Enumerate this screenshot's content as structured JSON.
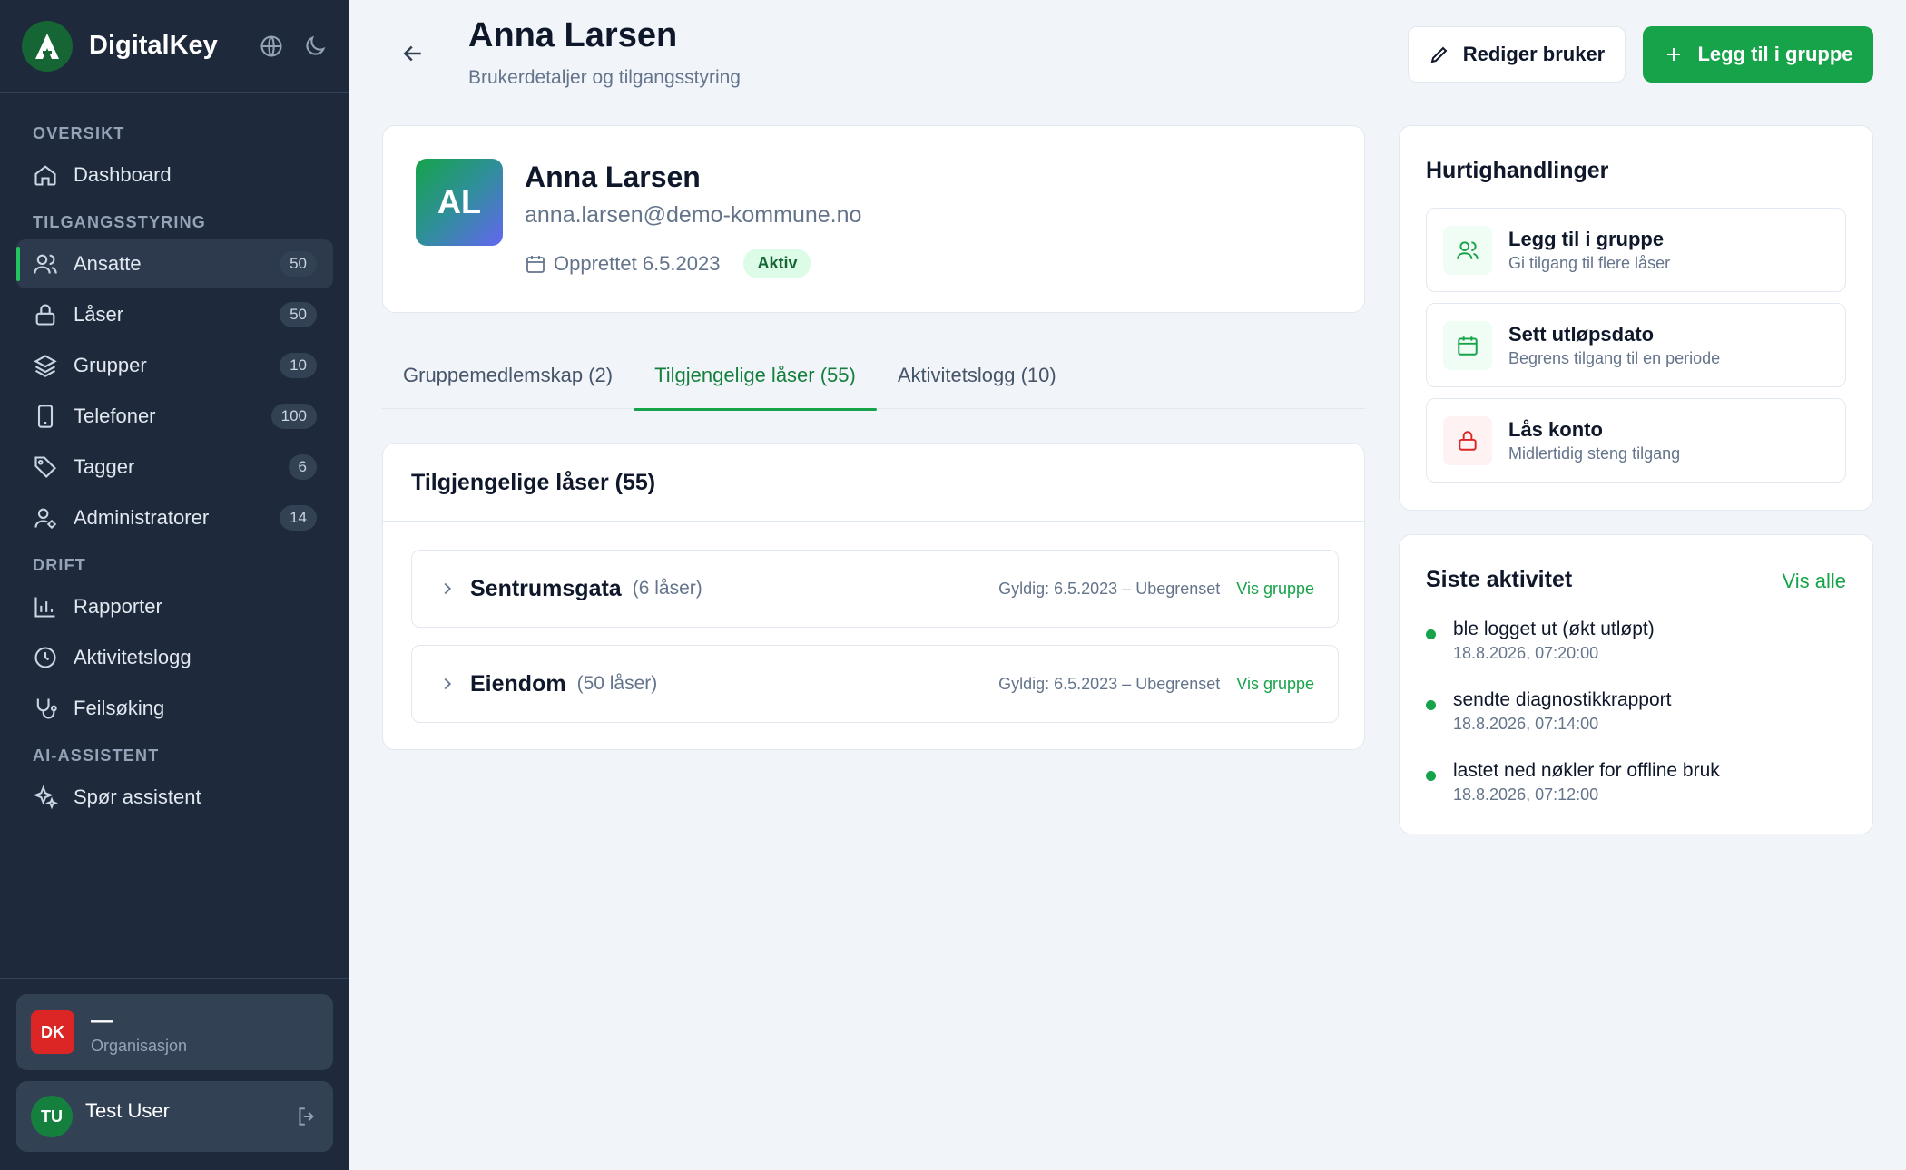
{
  "brand": {
    "name": "DigitalKey",
    "logo_letter": "A"
  },
  "sidebar": {
    "sections": [
      {
        "title": "OVERSIKT",
        "items": [
          {
            "label": "Dashboard",
            "icon": "home-icon",
            "count": ""
          }
        ]
      },
      {
        "title": "TILGANGSSTYRING",
        "items": [
          {
            "label": "Ansatte",
            "icon": "users-icon",
            "count": "50",
            "active": true
          },
          {
            "label": "Låser",
            "icon": "lock-icon",
            "count": "50"
          },
          {
            "label": "Grupper",
            "icon": "layers-icon",
            "count": "10"
          },
          {
            "label": "Telefoner",
            "icon": "phone-icon",
            "count": "100"
          },
          {
            "label": "Tagger",
            "icon": "tag-icon",
            "count": "6"
          },
          {
            "label": "Administratorer",
            "icon": "user-cog-icon",
            "count": "14"
          }
        ]
      },
      {
        "title": "DRIFT",
        "items": [
          {
            "label": "Rapporter",
            "icon": "bar-chart-icon",
            "count": ""
          },
          {
            "label": "Aktivitetslogg",
            "icon": "clock-icon",
            "count": ""
          },
          {
            "label": "Feilsøking",
            "icon": "stethoscope-icon",
            "count": ""
          }
        ]
      },
      {
        "title": "AI-ASSISTENT",
        "items": [
          {
            "label": "Spør assistent",
            "icon": "sparkles-icon",
            "count": ""
          }
        ]
      }
    ],
    "org": {
      "badge": "DK",
      "name": "—",
      "sub": "Organisasjon"
    },
    "user": {
      "initials": "TU",
      "name": "Test User"
    }
  },
  "header": {
    "title": "Anna Larsen",
    "subtitle": "Brukerdetaljer og tilgangsstyring",
    "edit_label": "Rediger bruker",
    "add_label": "Legg til i gruppe"
  },
  "profile": {
    "initials": "AL",
    "name": "Anna Larsen",
    "email": "anna.larsen@demo-kommune.no",
    "created": "Opprettet 6.5.2023",
    "status": "Aktiv"
  },
  "tabs": [
    {
      "label": "Gruppemedlemskap (2)",
      "active": false
    },
    {
      "label": "Tilgjengelige låser (55)",
      "active": true
    },
    {
      "label": "Aktivitetslogg (10)",
      "active": false
    }
  ],
  "locks": {
    "title": "Tilgjengelige låser (55)",
    "rows": [
      {
        "name": "Sentrumsgata",
        "count": "(6 låser)",
        "valid": "Gyldig: 6.5.2023 – Ubegrenset",
        "link": "Vis gruppe"
      },
      {
        "name": "Eiendom",
        "count": "(50 låser)",
        "valid": "Gyldig: 6.5.2023 – Ubegrenset",
        "link": "Vis gruppe"
      }
    ]
  },
  "quick_actions": {
    "title": "Hurtighandlinger",
    "items": [
      {
        "title": "Legg til i gruppe",
        "sub": "Gi tilgang til flere låser",
        "icon": "users-icon",
        "tone": "green"
      },
      {
        "title": "Sett utløpsdato",
        "sub": "Begrens tilgang til en periode",
        "icon": "calendar-icon",
        "tone": "green"
      },
      {
        "title": "Lås konto",
        "sub": "Midlertidig steng tilgang",
        "icon": "lock-icon",
        "tone": "red"
      }
    ]
  },
  "activity": {
    "title": "Siste aktivitet",
    "view_all": "Vis alle",
    "items": [
      {
        "text": "ble logget ut (økt utløpt)",
        "time": "18.8.2026, 07:20:00"
      },
      {
        "text": "sendte diagnostikkrapport",
        "time": "18.8.2026, 07:14:00"
      },
      {
        "text": "lastet ned nøkler for offline bruk",
        "time": "18.8.2026, 07:12:00"
      }
    ]
  },
  "colors": {
    "accent": "#16a34a",
    "sidebar": "#1e293b",
    "danger": "#dc2626"
  }
}
